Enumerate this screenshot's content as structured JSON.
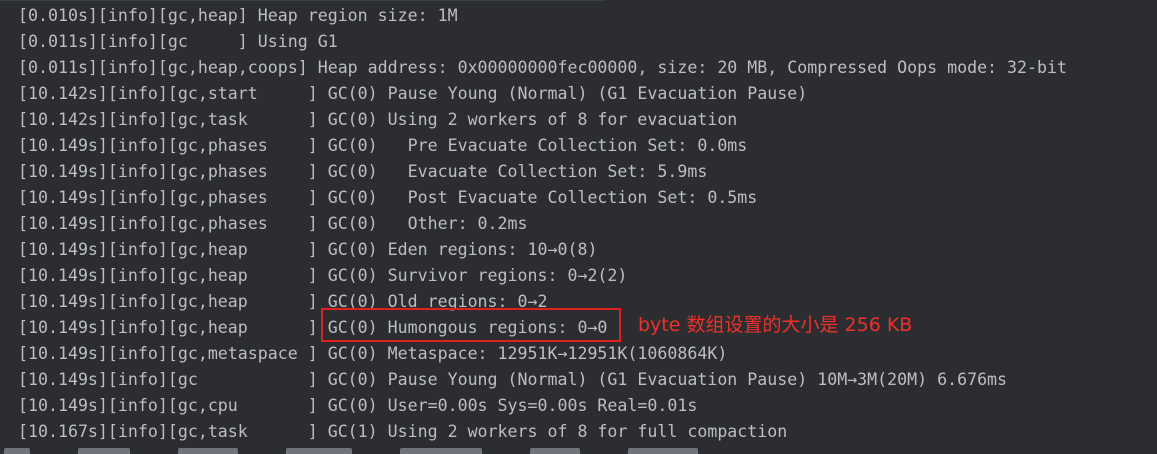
{
  "console": {
    "lines": [
      "[0.010s][info][gc,heap] Heap region size: 1M",
      "[0.011s][info][gc     ] Using G1",
      "[0.011s][info][gc,heap,coops] Heap address: 0x00000000fec00000, size: 20 MB, Compressed Oops mode: 32-bit",
      "[10.142s][info][gc,start     ] GC(0) Pause Young (Normal) (G1 Evacuation Pause)",
      "[10.142s][info][gc,task      ] GC(0) Using 2 workers of 8 for evacuation",
      "[10.149s][info][gc,phases    ] GC(0)   Pre Evacuate Collection Set: 0.0ms",
      "[10.149s][info][gc,phases    ] GC(0)   Evacuate Collection Set: 5.9ms",
      "[10.149s][info][gc,phases    ] GC(0)   Post Evacuate Collection Set: 0.5ms",
      "[10.149s][info][gc,phases    ] GC(0)   Other: 0.2ms",
      "[10.149s][info][gc,heap      ] GC(0) Eden regions: 10→0(8)",
      "[10.149s][info][gc,heap      ] GC(0) Survivor regions: 0→2(2)",
      "[10.149s][info][gc,heap      ] GC(0) Old regions: 0→2",
      "[10.149s][info][gc,heap      ] GC(0) Humongous regions: 0→0",
      "[10.149s][info][gc,metaspace ] GC(0) Metaspace: 12951K→12951K(1060864K)",
      "[10.149s][info][gc           ] GC(0) Pause Young (Normal) (G1 Evacuation Pause) 10M→3M(20M) 6.676ms",
      "[10.149s][info][gc,cpu       ] GC(0) User=0.00s Sys=0.00s Real=0.01s",
      "[10.167s][info][gc,task      ] GC(1) Using 2 workers of 8 for full compaction"
    ]
  },
  "annotation": {
    "text": "byte 数组设置的大小是 256 KB"
  },
  "colors": {
    "background": "#2b2d30",
    "text": "#bcbec4",
    "annotation": "#e0201b"
  }
}
